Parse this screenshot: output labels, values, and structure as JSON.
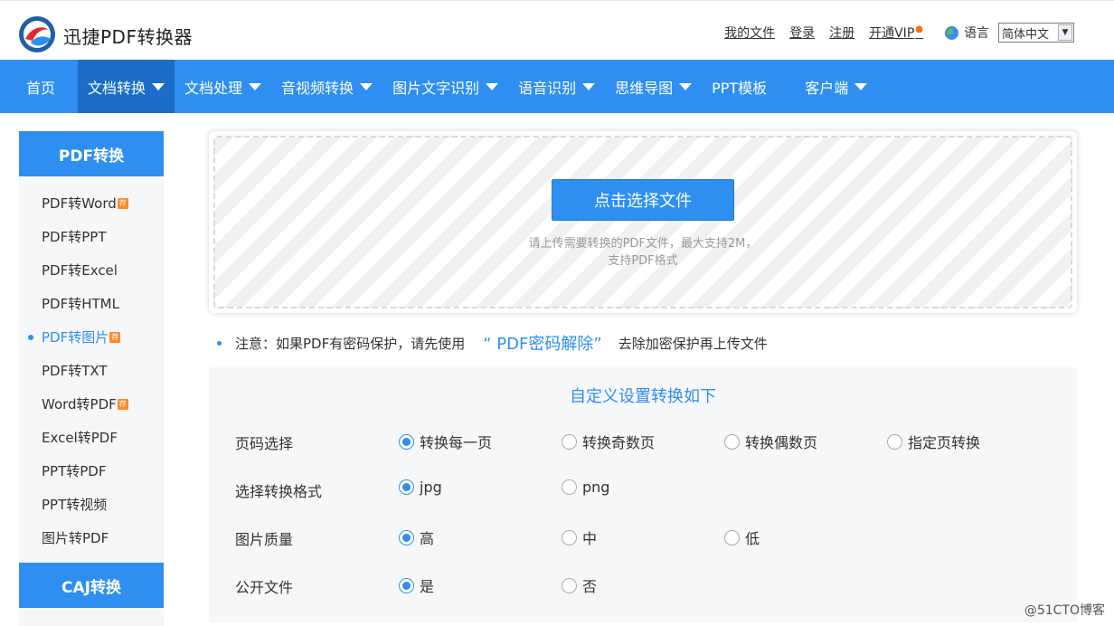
{
  "header": {
    "brand": "迅捷PDF转换器",
    "links": [
      "我的文件",
      "登录",
      "注册",
      "开通VIP"
    ],
    "language_label": "语言",
    "language_value": "简体中文"
  },
  "nav": {
    "items": [
      {
        "label": "首页",
        "active": false,
        "caret": false
      },
      {
        "label": "文档转换",
        "active": true,
        "caret": true
      },
      {
        "label": "文档处理",
        "active": false,
        "caret": true
      },
      {
        "label": "音视频转换",
        "active": false,
        "caret": true
      },
      {
        "label": "图片文字识别",
        "active": false,
        "caret": true
      },
      {
        "label": "语音识别",
        "active": false,
        "caret": true
      },
      {
        "label": "思维导图",
        "active": false,
        "caret": true
      },
      {
        "label": "PPT模板",
        "active": false,
        "caret": false
      },
      {
        "label": "客户端",
        "active": false,
        "caret": true
      }
    ]
  },
  "sidebar": {
    "heading": "PDF转换",
    "items": [
      {
        "label": "PDF转Word",
        "hot": true,
        "active": false
      },
      {
        "label": "PDF转PPT",
        "hot": false,
        "active": false
      },
      {
        "label": "PDF转Excel",
        "hot": false,
        "active": false
      },
      {
        "label": "PDF转HTML",
        "hot": false,
        "active": false
      },
      {
        "label": "PDF转图片",
        "hot": true,
        "active": true
      },
      {
        "label": "PDF转TXT",
        "hot": false,
        "active": false
      },
      {
        "label": "Word转PDF",
        "hot": true,
        "active": false
      },
      {
        "label": "Excel转PDF",
        "hot": false,
        "active": false
      },
      {
        "label": "PPT转PDF",
        "hot": false,
        "active": false
      },
      {
        "label": "PPT转视频",
        "hot": false,
        "active": false
      },
      {
        "label": "图片转PDF",
        "hot": false,
        "active": false
      }
    ],
    "heading2": "CAJ转换"
  },
  "upload": {
    "button_label": "点击选择文件",
    "hint_line1": "请上传需要转换的PDF文件，最大支持2M，",
    "hint_line2": "支持PDF格式"
  },
  "notice": {
    "prefix": "注意：如果PDF有密码保护，请先使用",
    "link": "“ PDF密码解除”",
    "suffix": "去除加密保护再上传文件"
  },
  "settings": {
    "title": "自定义设置转换如下",
    "rows": [
      {
        "label": "页码选择",
        "options": [
          "转换每一页",
          "转换奇数页",
          "转换偶数页",
          "指定页转换"
        ],
        "selected": 0
      },
      {
        "label": "选择转换格式",
        "options": [
          "jpg",
          "png"
        ],
        "selected": 0
      },
      {
        "label": "图片质量",
        "options": [
          "高",
          "中",
          "低"
        ],
        "selected": 0
      },
      {
        "label": "公开文件",
        "options": [
          "是",
          "否"
        ],
        "selected": 0
      }
    ]
  },
  "watermark": "@51CTO博客",
  "colors": {
    "accent": "#2e8ff0",
    "nav_active": "#1c6dc7",
    "hot_badge": "#ff8a2a"
  }
}
